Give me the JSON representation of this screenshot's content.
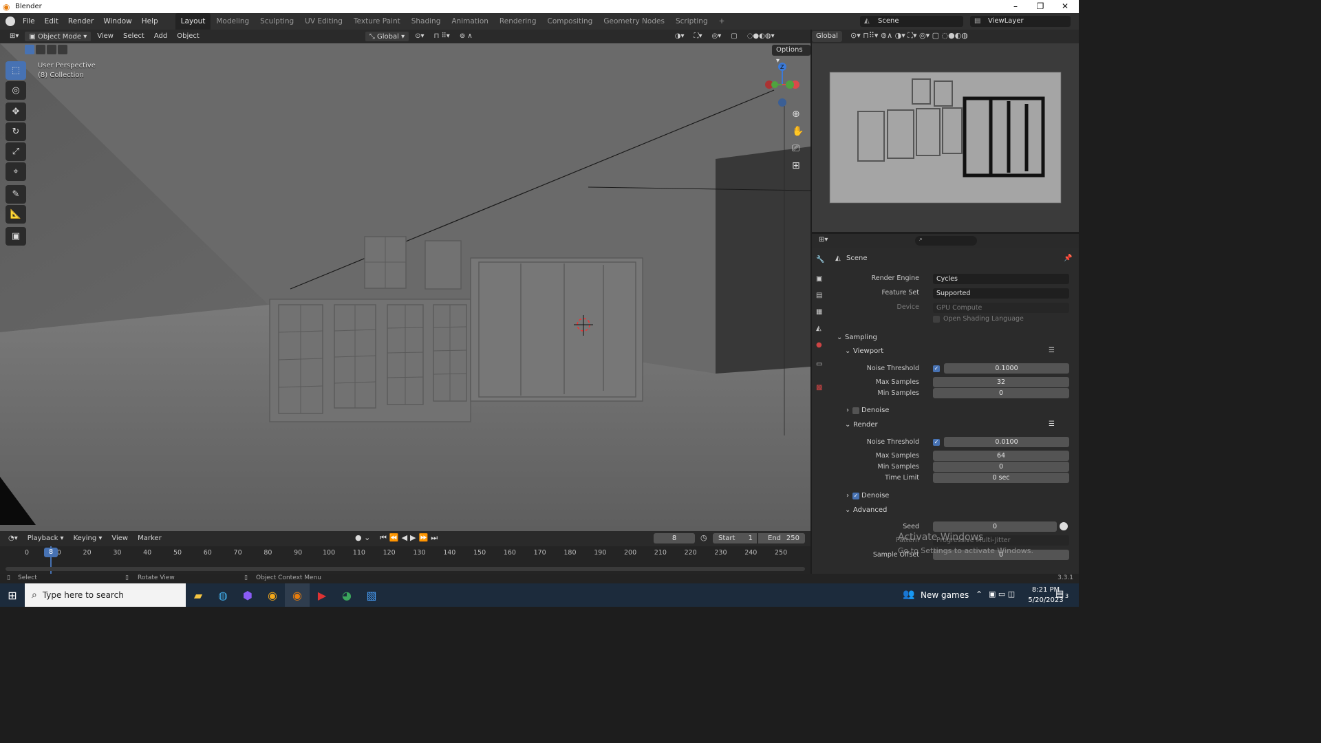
{
  "window": {
    "title": "Blender"
  },
  "menu": [
    "File",
    "Edit",
    "Render",
    "Window",
    "Help"
  ],
  "workspaces": [
    "Layout",
    "Modeling",
    "Sculpting",
    "UV Editing",
    "Texture Paint",
    "Shading",
    "Animation",
    "Rendering",
    "Compositing",
    "Geometry Nodes",
    "Scripting"
  ],
  "workspace_add": "+",
  "scene": {
    "name": "Scene",
    "view_layer": "ViewLayer"
  },
  "viewport_header": {
    "mode": "Object Mode",
    "menus": [
      "View",
      "Select",
      "Add",
      "Object"
    ],
    "orientation": "Global",
    "options_label": "Options"
  },
  "viewport_overlay": {
    "line1": "User Perspective",
    "line2": "(8) Collection"
  },
  "preview_header": {
    "orientation": "Global"
  },
  "properties": {
    "context": "Scene",
    "render_engine_label": "Render Engine",
    "render_engine": "Cycles",
    "feature_set_label": "Feature Set",
    "feature_set": "Supported",
    "device_label": "Device",
    "device": "GPU Compute",
    "osl_label": "Open Shading Language",
    "sampling": "Sampling",
    "viewport": {
      "title": "Viewport",
      "noise_threshold_label": "Noise Threshold",
      "noise_threshold": "0.1000",
      "max_samples_label": "Max Samples",
      "max_samples": "32",
      "min_samples_label": "Min Samples",
      "min_samples": "0",
      "denoise_label": "Denoise"
    },
    "render": {
      "title": "Render",
      "noise_threshold_label": "Noise Threshold",
      "noise_threshold": "0.0100",
      "max_samples_label": "Max Samples",
      "max_samples": "64",
      "min_samples_label": "Min Samples",
      "min_samples": "0",
      "time_limit_label": "Time Limit",
      "time_limit": "0 sec",
      "denoise_label": "Denoise"
    },
    "advanced": {
      "title": "Advanced",
      "seed_label": "Seed",
      "seed": "0",
      "pattern_label": "Pattern",
      "pattern": "Progressive Multi-Jitter",
      "sample_offset_label": "Sample Offset",
      "sample_offset": "0"
    }
  },
  "timeline": {
    "menus": [
      "Playback",
      "Keying",
      "View",
      "Marker"
    ],
    "current_frame": "8",
    "start_label": "Start",
    "start": "1",
    "end_label": "End",
    "end": "250",
    "ticks": [
      "0",
      "10",
      "20",
      "30",
      "40",
      "50",
      "60",
      "70",
      "80",
      "90",
      "100",
      "110",
      "120",
      "130",
      "140",
      "150",
      "160",
      "170",
      "180",
      "190",
      "200",
      "210",
      "220",
      "230",
      "240",
      "250"
    ]
  },
  "status": {
    "select": "Select",
    "rotate": "Rotate View",
    "context_menu": "Object Context Menu",
    "version": "3.3.1"
  },
  "watermark": {
    "line1": "Activate Windows",
    "line2": "Go to Settings to activate Windows."
  },
  "taskbar": {
    "search_placeholder": "Type here to search",
    "news": "New games",
    "time": "8:21 PM",
    "date": "5/20/2023",
    "notification_count": "3"
  },
  "colors": {
    "accent": "#4772b3",
    "timeline_cursor": "#4772b3",
    "blender_orange": "#e87d0d"
  }
}
